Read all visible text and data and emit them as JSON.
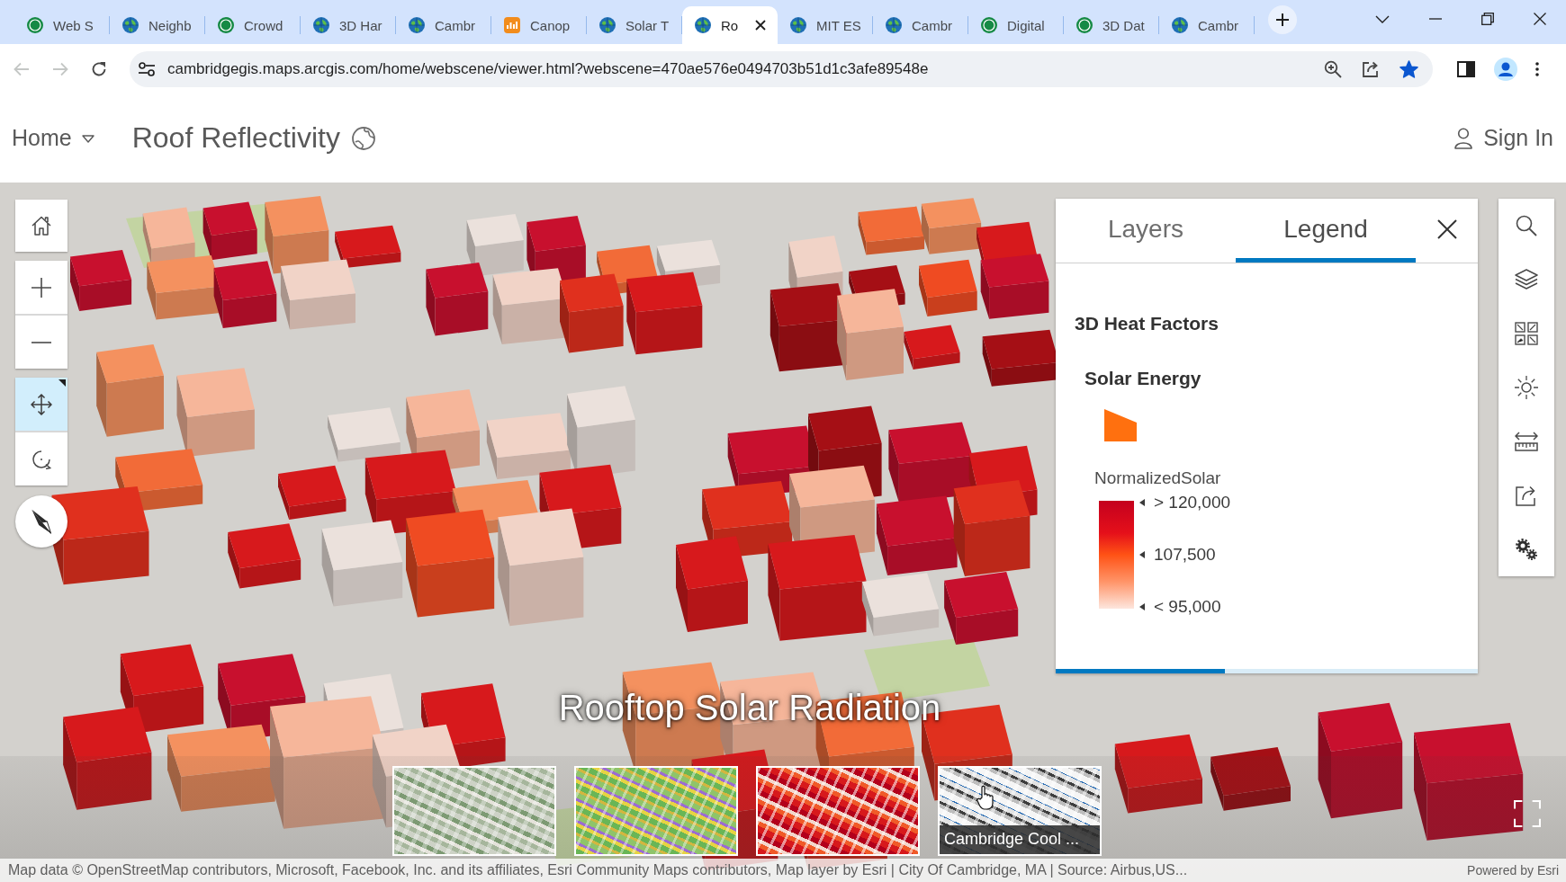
{
  "browser": {
    "tabs": [
      {
        "title": "Web S",
        "kind": "gis",
        "selected": false
      },
      {
        "title": "Neighb",
        "kind": "globe",
        "selected": false
      },
      {
        "title": "Crowd",
        "kind": "gis",
        "selected": false
      },
      {
        "title": "3D Har",
        "kind": "globe",
        "selected": false
      },
      {
        "title": "Cambr",
        "kind": "globe",
        "selected": false
      },
      {
        "title": "Canop",
        "kind": "app",
        "selected": false
      },
      {
        "title": "Solar T",
        "kind": "globe",
        "selected": false
      },
      {
        "title": "Ro",
        "kind": "globe",
        "selected": true
      },
      {
        "title": "MIT ES",
        "kind": "globe",
        "selected": false
      },
      {
        "title": "Cambr",
        "kind": "globe",
        "selected": false
      },
      {
        "title": "Digital",
        "kind": "gis",
        "selected": false
      },
      {
        "title": "3D Dat",
        "kind": "gis",
        "selected": false
      },
      {
        "title": "Cambr",
        "kind": "globe",
        "selected": false
      }
    ],
    "back_button": {
      "disabled": true
    },
    "forward_button": {
      "disabled": true
    },
    "address_bar": {
      "url": "cambridgegis.maps.arcgis.com/home/webscene/viewer.html?webscene=470ae576e0494703b51d1c3afe89548e",
      "bookmarked": true
    }
  },
  "header": {
    "home_menu": "Home",
    "title": "Roof Reflectivity",
    "sign_in": "Sign In"
  },
  "map": {
    "nav_modes": [
      {
        "kind": "pan",
        "selected": true
      },
      {
        "kind": "rotate",
        "selected": false
      }
    ],
    "slide_title": "Rooftop Solar Radiation",
    "slides": [
      {
        "kind": "aerial"
      },
      {
        "kind": "landuse"
      },
      {
        "kind": "solar"
      },
      {
        "kind": "grayscale",
        "caption": "Cambridge Cool ..."
      }
    ],
    "attribution": "Map data © OpenStreetMap contributors, Microsoft, Facebook, Inc. and its affiliates, Esri Community Maps contributors, Map layer by Esri | City Of Cambridge, MA | Source: Airbus,US...",
    "powered_by": "Powered by Esri"
  },
  "panel": {
    "tabs": [
      {
        "label": "Layers",
        "selected": false
      },
      {
        "label": "Legend",
        "selected": true
      }
    ],
    "legend": {
      "layer_title": "3D Heat Factors",
      "group_title": "Solar Energy",
      "field": "NormalizedSolar",
      "ramp_labels": [
        "> 120,000",
        "107,500",
        "< 95,000"
      ]
    },
    "loading_bar": {
      "level": 0.4
    }
  }
}
